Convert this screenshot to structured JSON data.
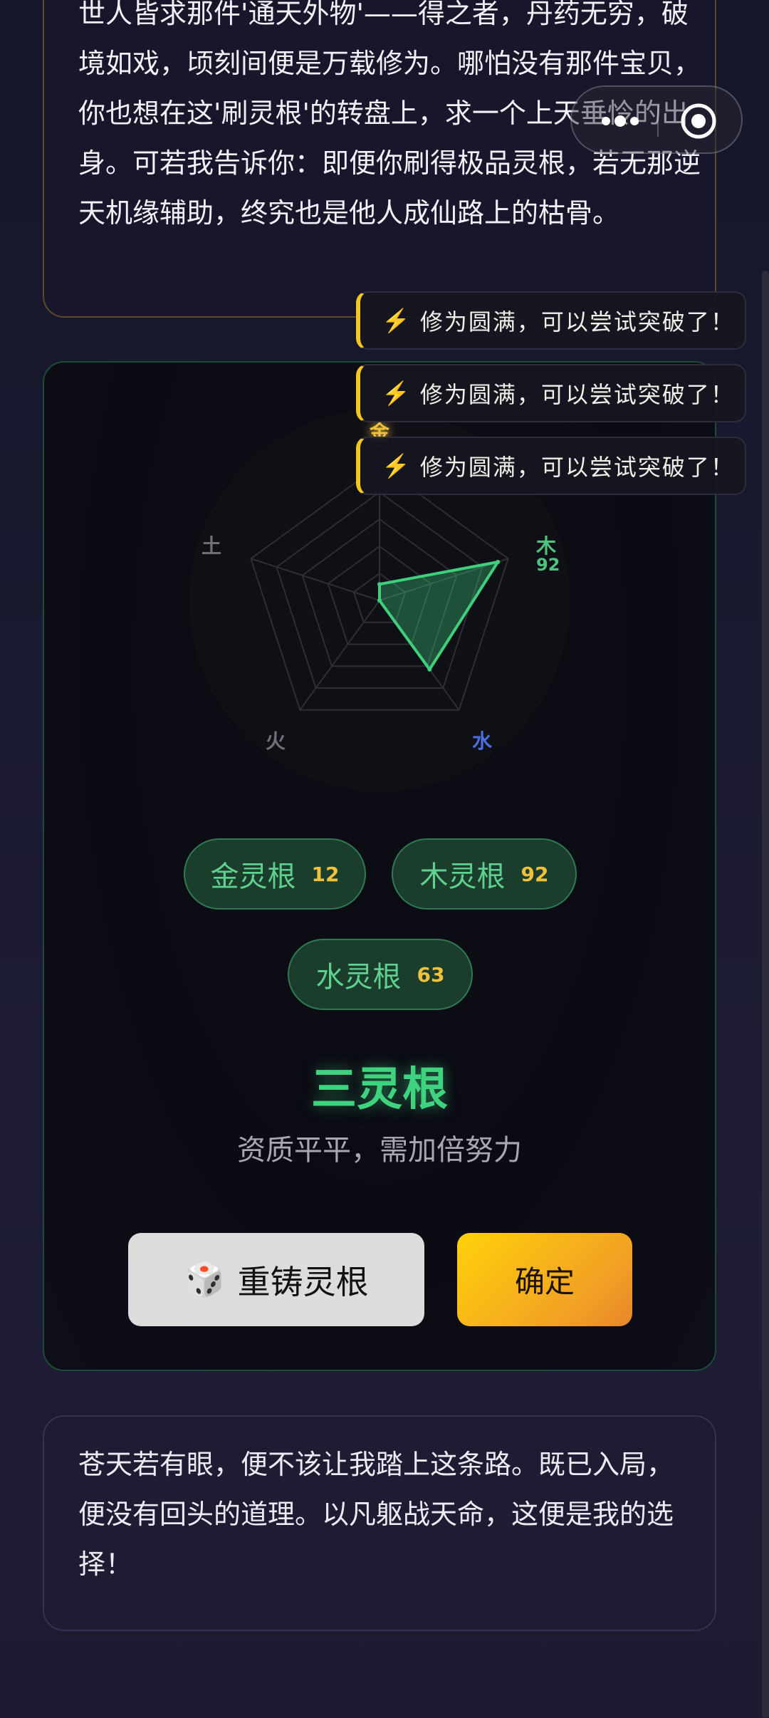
{
  "intro": {
    "text": "世人皆求那件'通天外物'——得之者，丹药无穷，破境如戏，顷刻间便是万载修为。哪怕没有那件宝贝，你也想在这'刷灵根'的转盘上，求一个上天垂怜的出身。可若我告诉你：即便你刷得极品灵根，若无那逆天机缘辅助，终究也是他人成仙路上的枯骨。"
  },
  "toasts": [
    {
      "icon": "⚡",
      "text": "修为圆满，可以尝试突破了！"
    },
    {
      "icon": "⚡",
      "text": "修为圆满，可以尝试突破了！"
    },
    {
      "icon": "⚡",
      "text": "修为圆满，可以尝试突破了！"
    }
  ],
  "chart_data": {
    "type": "radar",
    "axes": [
      "金",
      "木",
      "水",
      "火",
      "土"
    ],
    "values": [
      12,
      92,
      63,
      0,
      0
    ],
    "value_labels": {
      "木": "92"
    },
    "range": [
      0,
      100
    ],
    "grid_levels": 5,
    "colors": {
      "fill": "#3fcf7d",
      "grid": "#2e2e36",
      "金": "#f0c23c",
      "木": "#4fc37e",
      "水": "#4a6ee0",
      "火": "#6f6f78",
      "土": "#6f6f78"
    }
  },
  "roots": [
    {
      "name": "金灵根",
      "value": "12"
    },
    {
      "name": "木灵根",
      "value": "92"
    },
    {
      "name": "水灵根",
      "value": "63"
    }
  ],
  "result": {
    "title": "三灵根",
    "desc": "资质平平，需加倍努力"
  },
  "buttons": {
    "reroll_icon": "🎲",
    "reroll": "重铸灵根",
    "confirm": "确定"
  },
  "quote": {
    "text": "苍天若有眼，便不该让我踏上这条路。既已入局，便没有回头的道理。以凡躯战天命，这便是我的选择！"
  },
  "capsule": {
    "more_icon": "more-dots-icon",
    "close_icon": "target-close-icon"
  }
}
